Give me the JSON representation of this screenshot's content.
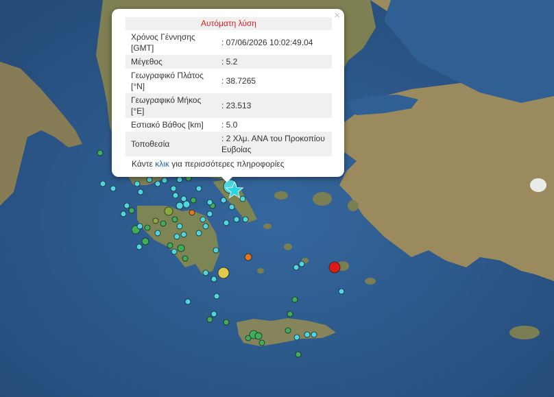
{
  "map": {
    "colors": {
      "sea": "#2f5b8e",
      "land": "#8f8559",
      "marker_cyan": "#4fd6e0",
      "marker_green": "#3fae58",
      "marker_olive": "#8aa83c",
      "marker_orange": "#e5761b",
      "marker_yellow": "#dfc84a",
      "marker_red": "#dd1a16",
      "selected_star": "#28d9e3"
    },
    "selected_marker_icon": "star-icon"
  },
  "popup": {
    "header": "Αυτόματη λύση",
    "close_symbol": "×",
    "fields": [
      {
        "label": "Χρόνος Γέννησης [GMT]",
        "value": ": 07/06/2026 10:02:49.04"
      },
      {
        "label": "Μέγεθος",
        "value": ": 5.2"
      },
      {
        "label": "Γεωγραφικό Πλάτος [°N]",
        "value": ": 38.7265"
      },
      {
        "label": "Γεωγραφικό Μήκος [°E]",
        "value": ": 23.513"
      },
      {
        "label": "Εστιακό Βάθος [km]",
        "value": ": 5.0"
      },
      {
        "label": "Τοποθεσία",
        "value": ": 2 Χλμ. ΑΝΑ του Προκοπίου Ευβοίας"
      }
    ],
    "more_prefix": "Κάντε",
    "more_link": "κλικ",
    "more_suffix": "για περισσότερες πληροφορίες"
  }
}
